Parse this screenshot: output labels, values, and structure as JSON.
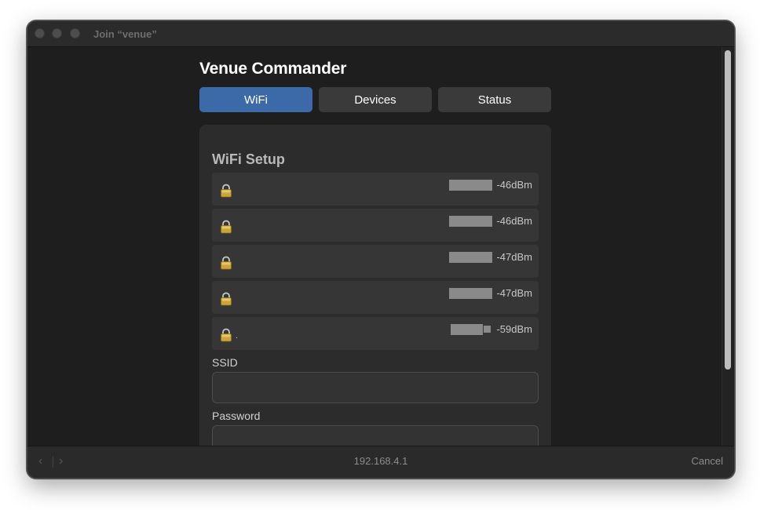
{
  "window": {
    "title": "Join “venue”"
  },
  "app": {
    "title": "Venue Commander"
  },
  "tabs": [
    {
      "label": "WiFi",
      "active": true
    },
    {
      "label": "Devices",
      "active": false
    },
    {
      "label": "Status",
      "active": false
    }
  ],
  "wifi": {
    "section_title": "WiFi Setup",
    "networks": [
      {
        "name": "",
        "rssi": "-46dBm",
        "icon": "lock-icon",
        "secured": true
      },
      {
        "name": "",
        "rssi": "-46dBm",
        "icon": "lock-icon",
        "secured": true
      },
      {
        "name": "",
        "rssi": "-47dBm",
        "icon": "lock-icon",
        "secured": true
      },
      {
        "name": "",
        "rssi": "-47dBm",
        "icon": "lock-icon",
        "secured": true
      },
      {
        "name": ".",
        "rssi": "-59dBm",
        "icon": "lock-icon",
        "secured": true
      }
    ],
    "ssid_label": "SSID",
    "ssid_value": "",
    "password_label": "Password",
    "password_value": ""
  },
  "bottom": {
    "back_icon": "chevron-left-icon",
    "forward_icon": "chevron-right-icon",
    "url": "192.168.4.1",
    "cancel_label": "Cancel"
  },
  "colors": {
    "accent": "#3c6aa8",
    "window_bg": "#1e1e1e",
    "panel_bg": "#2c2c2c",
    "row_bg": "#363636"
  }
}
